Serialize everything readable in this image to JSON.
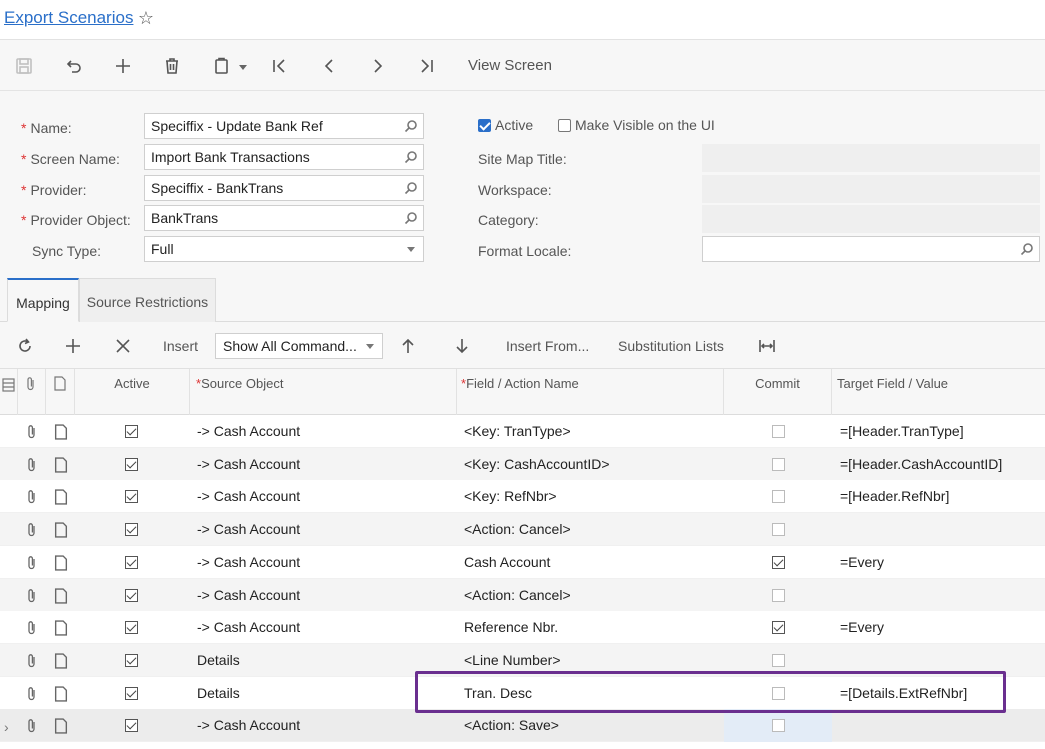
{
  "title": "Export Scenarios",
  "toolbar": {
    "view_screen_label": "View Screen"
  },
  "form": {
    "name_label": "Name:",
    "name_value": "Speciffix - Update Bank Ref",
    "screen_name_label": "Screen Name:",
    "screen_name_value": "Import Bank Transactions",
    "provider_label": "Provider:",
    "provider_value": "Speciffix - BankTrans",
    "provider_object_label": "Provider Object:",
    "provider_object_value": "BankTrans",
    "sync_type_label": "Sync Type:",
    "sync_type_value": "Full",
    "required_mark": "*",
    "active_label": "Active",
    "active_checked": true,
    "make_visible_label": "Make Visible on the UI",
    "make_visible_checked": false,
    "site_map_title_label": "Site Map Title:",
    "workspace_label": "Workspace:",
    "category_label": "Category:",
    "format_locale_label": "Format Locale:"
  },
  "tabs": [
    {
      "label": "Mapping",
      "active": true
    },
    {
      "label": "Source Restrictions",
      "active": false
    }
  ],
  "grid_toolbar": {
    "insert_label": "Insert",
    "show_commands_value": "Show All Command...",
    "insert_from_label": "Insert From...",
    "substitution_lists_label": "Substitution Lists"
  },
  "grid": {
    "headers": {
      "active": "Active",
      "source_object": "Source Object",
      "field_action": "Field / Action Name",
      "commit": "Commit",
      "target": "Target Field / Value",
      "required_mark": "*"
    },
    "rows": [
      {
        "active": true,
        "source": "-> Cash Account",
        "field": "<Key: TranType>",
        "commit": false,
        "target": "=[Header.TranType]"
      },
      {
        "active": true,
        "source": "-> Cash Account",
        "field": "<Key: CashAccountID>",
        "commit": false,
        "target": "=[Header.CashAccountID]"
      },
      {
        "active": true,
        "source": "-> Cash Account",
        "field": "<Key: RefNbr>",
        "commit": false,
        "target": "=[Header.RefNbr]"
      },
      {
        "active": true,
        "source": "-> Cash Account",
        "field": "<Action: Cancel>",
        "commit": false,
        "target": ""
      },
      {
        "active": true,
        "source": "-> Cash Account",
        "field": "Cash Account",
        "commit": true,
        "target": "=Every"
      },
      {
        "active": true,
        "source": "-> Cash Account",
        "field": "<Action: Cancel>",
        "commit": false,
        "target": ""
      },
      {
        "active": true,
        "source": "-> Cash Account",
        "field": "Reference Nbr.",
        "commit": true,
        "target": "=Every"
      },
      {
        "active": true,
        "source": "Details",
        "field": "<Line Number>",
        "commit": false,
        "target": ""
      },
      {
        "active": true,
        "source": "Details",
        "field": "Tran. Desc",
        "commit": false,
        "target": "=[Details.ExtRefNbr]"
      },
      {
        "active": true,
        "source": "-> Cash Account",
        "field": "<Action: Save>",
        "commit": false,
        "target": ""
      }
    ]
  },
  "colors": {
    "link": "#2a6fc9",
    "highlight_box": "#6a2f8f",
    "required": "#d33"
  }
}
